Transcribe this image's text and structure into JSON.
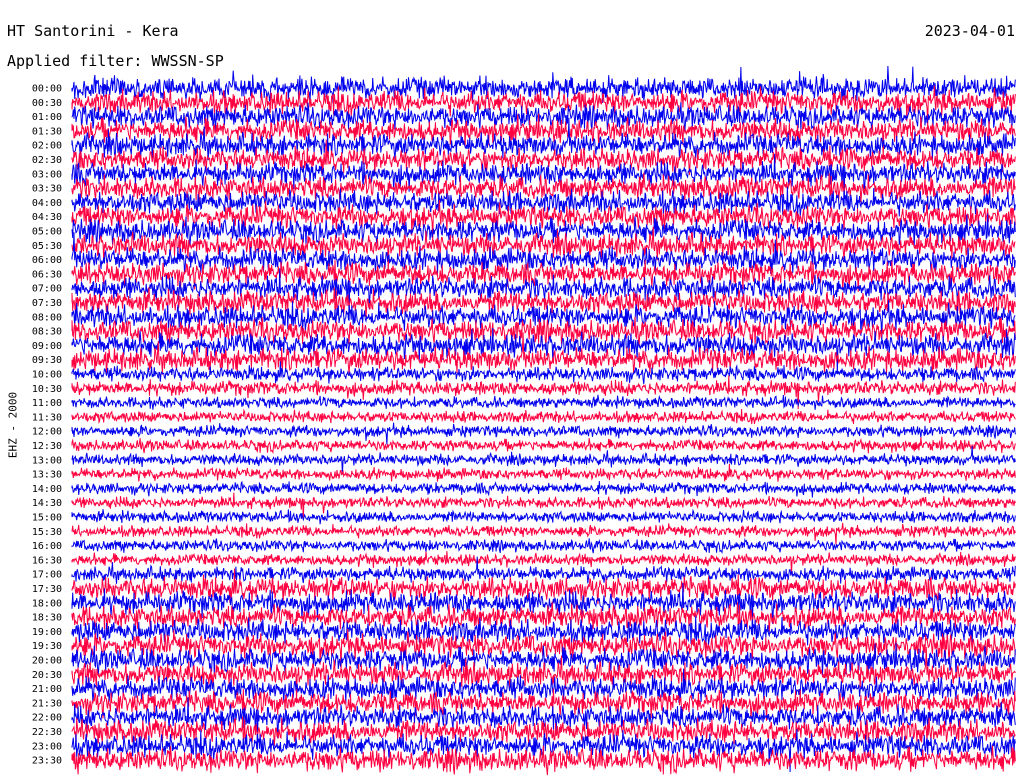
{
  "header": {
    "title": "HT Santorini - Kera",
    "date": "2023-04-01",
    "filter": "Applied filter: WWSSN-SP"
  },
  "chart_data": {
    "type": "line",
    "ylabel": "EHZ - 2000",
    "tick_labels": [
      "00:00",
      "00:30",
      "01:00",
      "01:30",
      "02:00",
      "02:30",
      "03:00",
      "03:30",
      "04:00",
      "04:30",
      "05:00",
      "05:30",
      "06:00",
      "06:30",
      "07:00",
      "07:30",
      "08:00",
      "08:30",
      "09:00",
      "09:30",
      "10:00",
      "10:30",
      "11:00",
      "11:30",
      "12:00",
      "12:30",
      "13:00",
      "13:30",
      "14:00",
      "14:30",
      "15:00",
      "15:30",
      "16:00",
      "16:30",
      "17:00",
      "17:30",
      "18:00",
      "18:30",
      "19:00",
      "19:30",
      "20:00",
      "20:30",
      "21:00",
      "21:30",
      "22:00",
      "22:30",
      "23:00",
      "23:30"
    ],
    "trace_colors": [
      "#0000ee",
      "#ff0040"
    ],
    "grid": false
  }
}
